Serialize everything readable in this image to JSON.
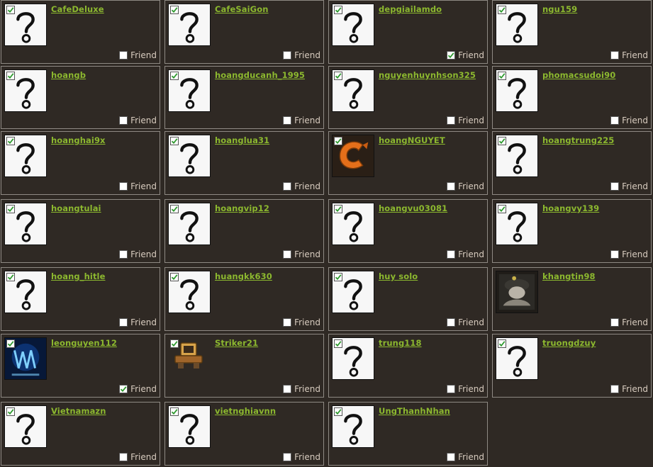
{
  "friend_label": "Friend",
  "colors": {
    "background": "#2f2924",
    "card_border": "#8f8a84",
    "username_link": "#8cb82f",
    "friend_text": "#d8ccbf",
    "check_mark": "#2f9a2f"
  },
  "users": [
    {
      "name": "CafeDeluxe",
      "avatar": "question-mark-icon",
      "selected": true,
      "friend": false
    },
    {
      "name": "CafeSaiGon",
      "avatar": "question-mark-icon",
      "selected": true,
      "friend": false
    },
    {
      "name": "depgiailamdo",
      "avatar": "question-mark-icon",
      "selected": true,
      "friend": true
    },
    {
      "name": "ngu159",
      "avatar": "question-mark-icon",
      "selected": true,
      "friend": false
    },
    {
      "name": "hoangb",
      "avatar": "question-mark-icon",
      "selected": true,
      "friend": false
    },
    {
      "name": "hoangducanh_1995",
      "avatar": "question-mark-icon",
      "selected": true,
      "friend": false
    },
    {
      "name": "nguyenhuynhson325",
      "avatar": "question-mark-icon",
      "selected": true,
      "friend": false
    },
    {
      "name": "phomacsudoi90",
      "avatar": "question-mark-icon",
      "selected": true,
      "friend": false
    },
    {
      "name": "hoanghai9x",
      "avatar": "question-mark-icon",
      "selected": true,
      "friend": false
    },
    {
      "name": "hoanglua31",
      "avatar": "question-mark-icon",
      "selected": true,
      "friend": false
    },
    {
      "name": "hoangNGUYET",
      "avatar": "orange-c-icon",
      "selected": true,
      "friend": false
    },
    {
      "name": "hoangtrung225",
      "avatar": "question-mark-icon",
      "selected": true,
      "friend": false
    },
    {
      "name": "hoangtulai",
      "avatar": "question-mark-icon",
      "selected": true,
      "friend": false
    },
    {
      "name": "hoangvip12",
      "avatar": "question-mark-icon",
      "selected": true,
      "friend": false
    },
    {
      "name": "hoangvu03081",
      "avatar": "question-mark-icon",
      "selected": true,
      "friend": false
    },
    {
      "name": "hoangvy139",
      "avatar": "question-mark-icon",
      "selected": true,
      "friend": false
    },
    {
      "name": "hoang_hitle",
      "avatar": "question-mark-icon",
      "selected": true,
      "friend": false
    },
    {
      "name": "huangkk630",
      "avatar": "question-mark-icon",
      "selected": true,
      "friend": false
    },
    {
      "name": "huy solo",
      "avatar": "question-mark-icon",
      "selected": true,
      "friend": false
    },
    {
      "name": "khangtin98",
      "avatar": "photo-avatar-icon",
      "selected": false,
      "friend": false
    },
    {
      "name": "leonguyen112",
      "avatar": "blue-logo-icon",
      "selected": true,
      "friend": true
    },
    {
      "name": "Striker21",
      "avatar": "robot-icon",
      "selected": true,
      "friend": false
    },
    {
      "name": "trung118",
      "avatar": "question-mark-icon",
      "selected": true,
      "friend": false
    },
    {
      "name": "truongdzuy",
      "avatar": "question-mark-icon",
      "selected": true,
      "friend": false
    },
    {
      "name": "Vietnamazn",
      "avatar": "question-mark-icon",
      "selected": true,
      "friend": false
    },
    {
      "name": "vietnghiavnn",
      "avatar": "question-mark-icon",
      "selected": true,
      "friend": false
    },
    {
      "name": "UngThanhNhan",
      "avatar": "question-mark-icon",
      "selected": true,
      "friend": false
    }
  ]
}
